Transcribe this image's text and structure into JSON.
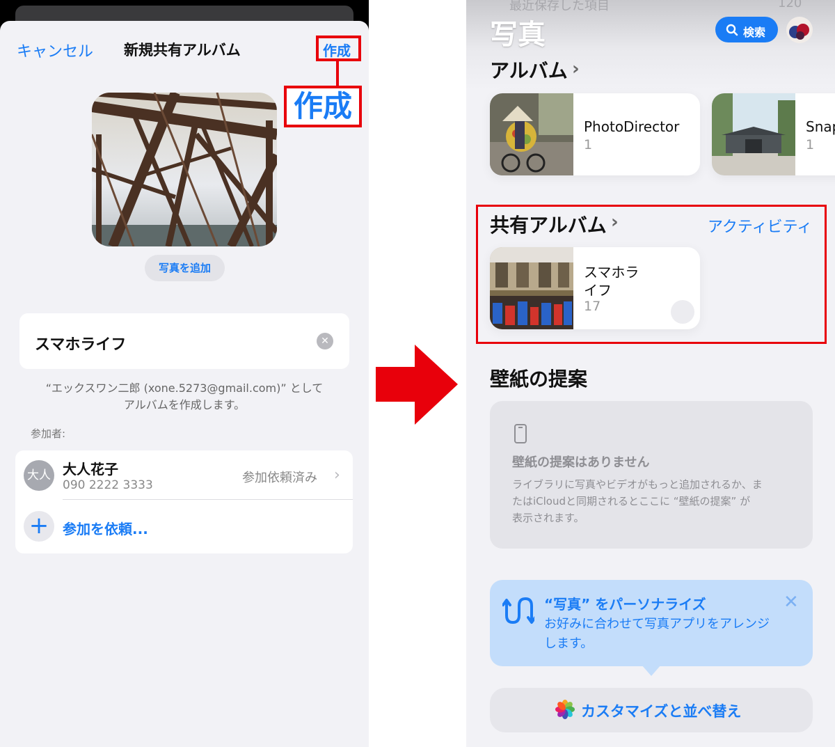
{
  "left_screen": {
    "nav": {
      "cancel_label": "キャンセル",
      "title": "新規共有アルバム",
      "create_label": "作成"
    },
    "callout_label": "作成",
    "add_photo_label": "写真を追加",
    "album_name_value": "スマホライフ",
    "owner_note_line1": "“エックスワン二郎 (xone.5273@gmail.com)” として",
    "owner_note_line2": "アルバムを作成します。",
    "participants_label": "参加者:",
    "participant": {
      "avatar_initials": "大人",
      "name": "大人花子",
      "phone": "090 2222 3333",
      "status": "参加依頼済み"
    },
    "invite_label": "参加を依頼..."
  },
  "right_screen": {
    "faded_header_text": "最近保存した項目",
    "faded_header_count": "120",
    "title": "写真",
    "search_label": "検索",
    "albums_section_title": "アルバム",
    "albums": [
      {
        "name": "PhotoDirector",
        "count": "1"
      },
      {
        "name": "Snap",
        "count": "1"
      }
    ],
    "shared_section_title": "共有アルバム",
    "activity_label": "アクティビティ",
    "shared_album": {
      "name_line1": "スマホラ",
      "name_line2": "イフ",
      "count": "17"
    },
    "wallpaper_section_title": "壁紙の提案",
    "wallpaper_empty_title": "壁紙の提案はありません",
    "wallpaper_empty_line1": "ライブラリに写真やビデオがもっと追加されるか、ま",
    "wallpaper_empty_line2": "たはiCloudと同期されるとここに “壁紙の提案” が",
    "wallpaper_empty_line3": "表示されます。",
    "personalize_title": "“写真” をパーソナライズ",
    "personalize_line1": "お好みに合わせて写真アプリをアレンジ",
    "personalize_line2": "します。",
    "customize_label": "カスタマイズと並べ替え"
  },
  "colors": {
    "accent_blue": "#1a7cf5",
    "highlight_red": "#e8000b"
  }
}
